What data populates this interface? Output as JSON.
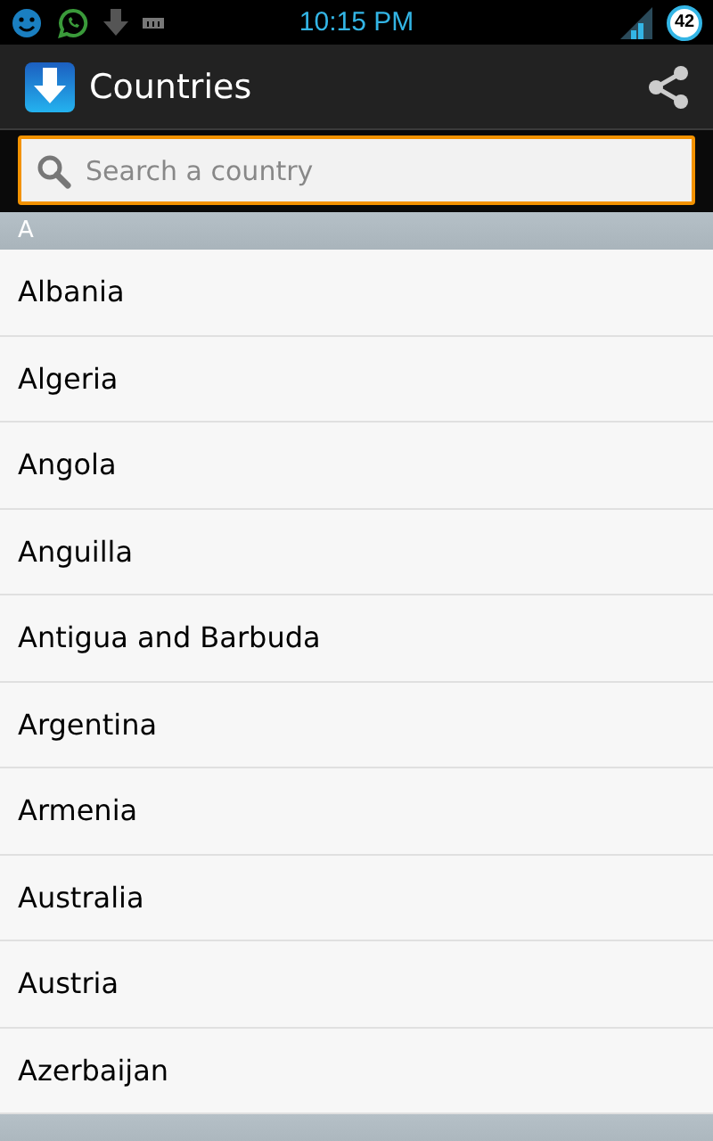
{
  "status_bar": {
    "time": "10:15 PM",
    "battery": "42"
  },
  "action_bar": {
    "title": "Countries"
  },
  "search": {
    "placeholder": "Search a country",
    "focused": true
  },
  "sections": [
    {
      "letter": "A",
      "countries": [
        "Albania",
        "Algeria",
        "Angola",
        "Anguilla",
        "Antigua and Barbuda",
        "Argentina",
        "Armenia",
        "Australia",
        "Austria",
        "Azerbaijan"
      ]
    }
  ]
}
